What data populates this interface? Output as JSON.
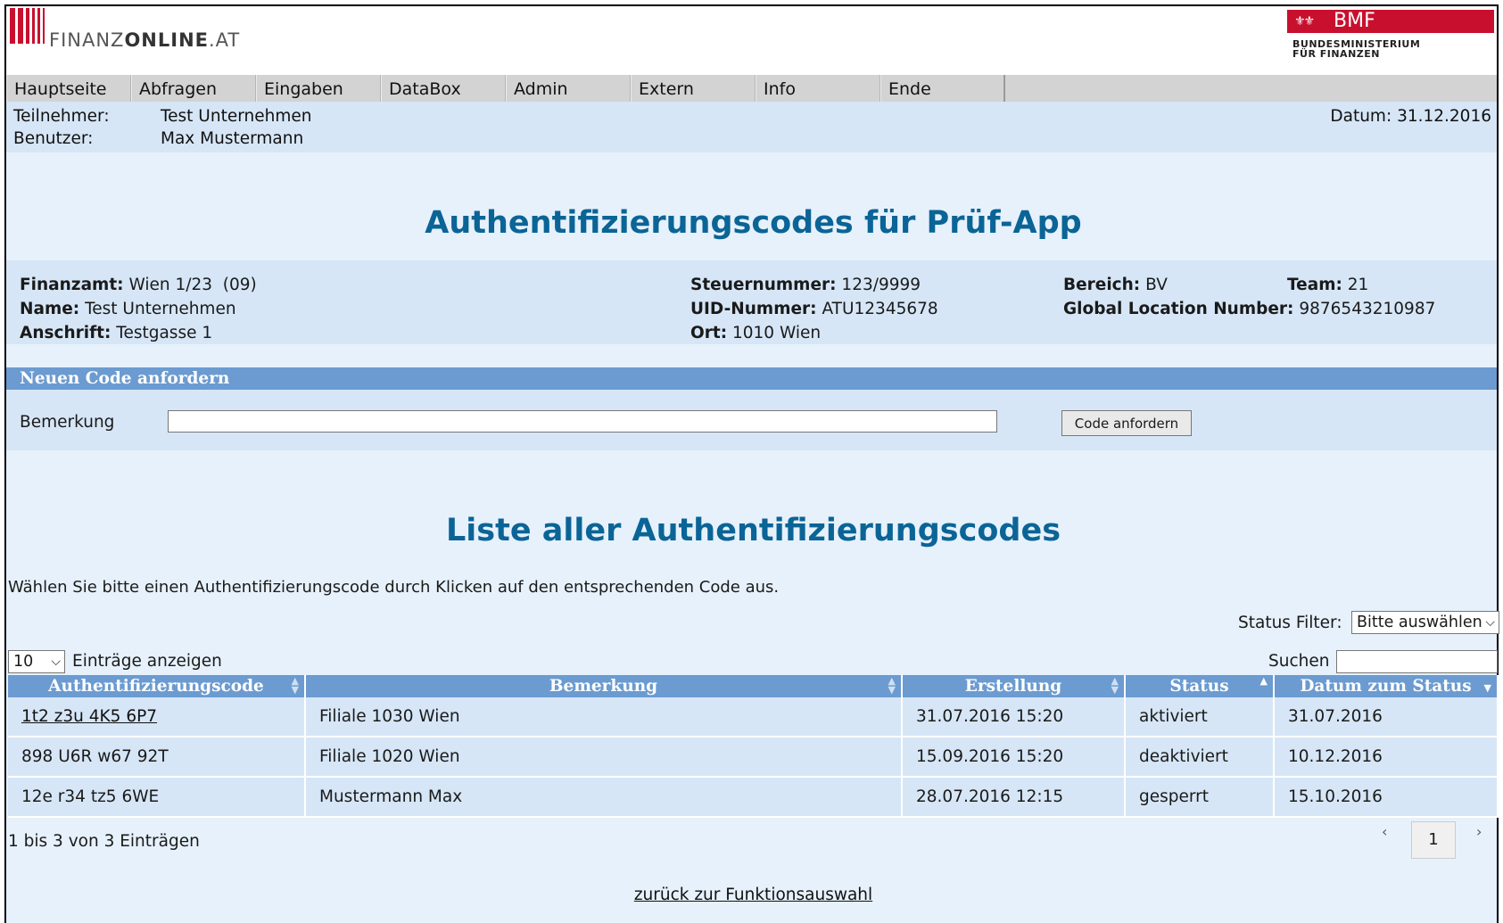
{
  "brand": {
    "logo_part1": "FINANZ",
    "logo_part2": "ONLINE",
    "logo_part3": ".AT",
    "bmf_label": "BMF",
    "bmf_sub_line1": "BUNDESMINISTERIUM",
    "bmf_sub_line2": "FÜR FINANZEN",
    "accent": "#c8102e"
  },
  "nav": [
    "Hauptseite",
    "Abfragen",
    "Eingaben",
    "DataBox",
    "Admin",
    "Extern",
    "Info",
    "Ende"
  ],
  "userbar": {
    "teilnehmer_label": "Teilnehmer:",
    "teilnehmer_value": "Test Unternehmen",
    "benutzer_label": "Benutzer:",
    "benutzer_value": "Max Mustermann",
    "datum": "Datum: 31.12.2016"
  },
  "page_title": "Authentifizierungscodes für Prüf-App",
  "info": {
    "finanzamt_label": "Finanzamt:",
    "finanzamt_value": "Wien 1/23  (09)",
    "name_label": "Name:",
    "name_value": "Test Unternehmen",
    "anschrift_label": "Anschrift:",
    "anschrift_value": "Testgasse 1",
    "steuernummer_label": "Steuernummer:",
    "steuernummer_value": "123/9999",
    "uid_label": "UID-Nummer:",
    "uid_value": "ATU12345678",
    "ort_label": "Ort:",
    "ort_value": "1010 Wien",
    "bereich_label": "Bereich:",
    "bereich_value": "BV",
    "team_label": "Team:",
    "team_value": "21",
    "gln_label": "Global Location Number:",
    "gln_value": "9876543210987"
  },
  "request": {
    "section_title": "Neuen Code anfordern",
    "bemerkung_label": "Bemerkung",
    "bemerkung_value": "",
    "button_label": "Code anfordern"
  },
  "list": {
    "title": "Liste aller Authentifizierungscodes",
    "hint": "Wählen Sie bitte einen Authentifizierungscode durch Klicken auf den entsprechenden Code aus.",
    "status_filter_label": "Status Filter:",
    "status_filter_value": "Bitte auswählen",
    "page_size_value": "10",
    "entries_label": "Einträge anzeigen",
    "search_label": "Suchen",
    "search_value": "",
    "columns": [
      "Authentifizierungscode",
      "Bemerkung",
      "Erstellung",
      "Status",
      "Datum zum Status"
    ],
    "rows": [
      {
        "code": "1t2 z3u 4K5 6P7",
        "bemerkung": "Filiale 1030 Wien",
        "erstellung": "31.07.2016 15:20",
        "status": "aktiviert",
        "datum": "31.07.2016"
      },
      {
        "code": "898 U6R w67 92T",
        "bemerkung": "Filiale 1020 Wien",
        "erstellung": "15.09.2016 15:20",
        "status": "deaktiviert",
        "datum": "10.12.2016"
      },
      {
        "code": "12e r34 tz5 6WE",
        "bemerkung": "Mustermann Max",
        "erstellung": "28.07.2016 12:15",
        "status": "gesperrt",
        "datum": "15.10.2016"
      }
    ],
    "info_text": "1 bis 3 von 3 Einträgen",
    "prev_label": "‹",
    "current_page": "1",
    "next_label": "›"
  },
  "back_link": "zurück zur Funktionsauswahl"
}
